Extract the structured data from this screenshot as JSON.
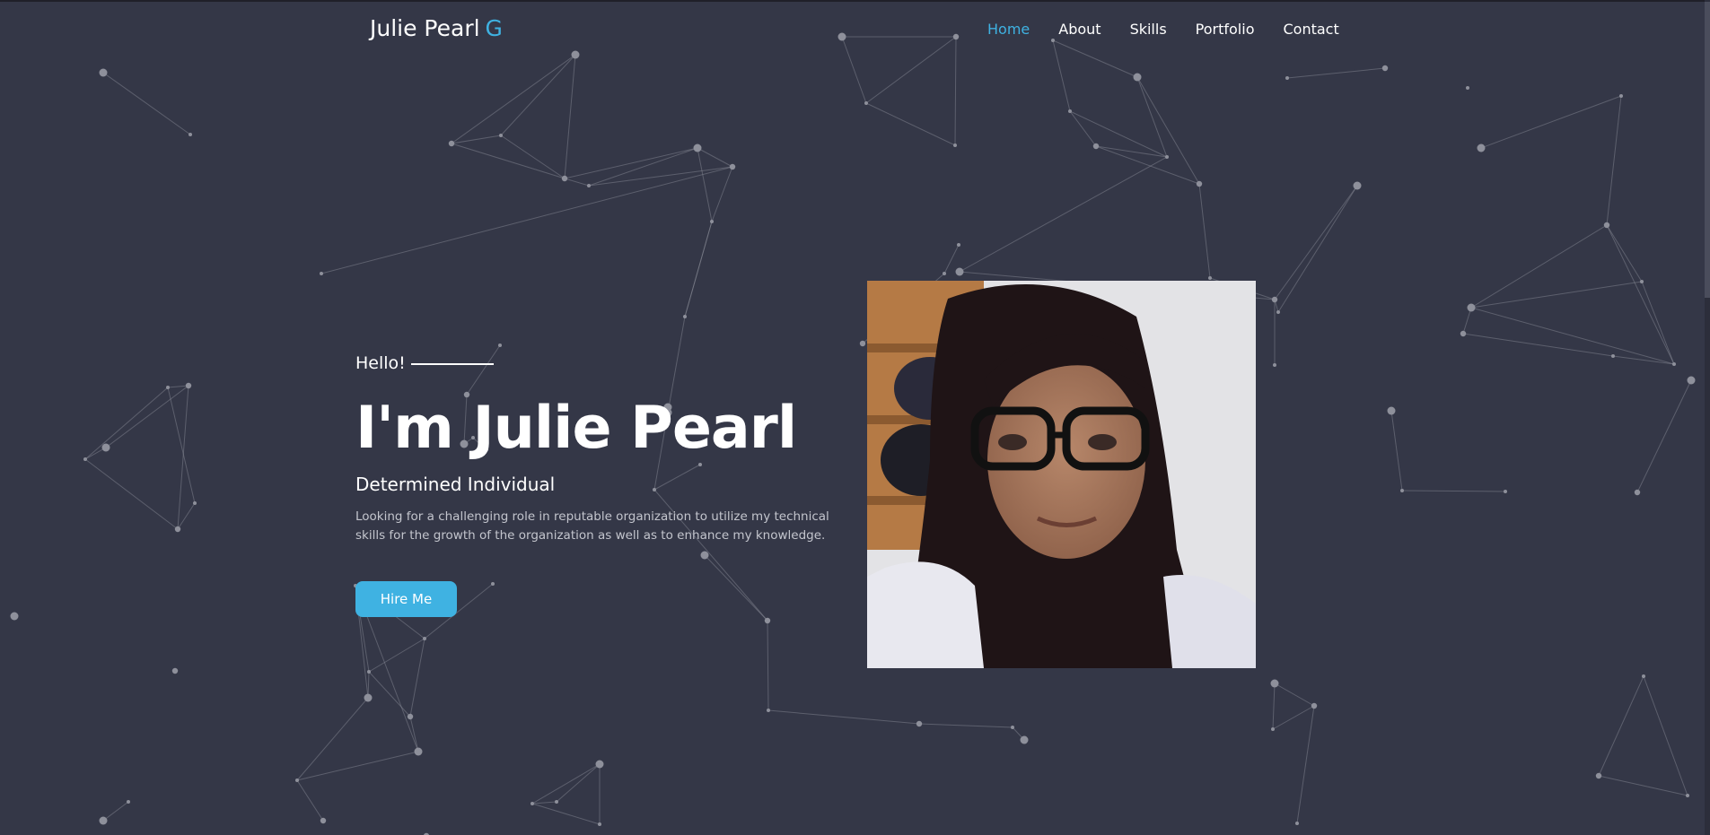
{
  "brand": {
    "name": "Julie Pearl",
    "mark": "G"
  },
  "nav": {
    "items": [
      {
        "label": "Home",
        "active": true
      },
      {
        "label": "About",
        "active": false
      },
      {
        "label": "Skills",
        "active": false
      },
      {
        "label": "Portfolio",
        "active": false
      },
      {
        "label": "Contact",
        "active": false
      }
    ]
  },
  "hero": {
    "greeting": "Hello!",
    "headline": "I'm Julie Pearl",
    "subtitle": "Determined Individual",
    "description": "Looking for a challenging role in reputable organization to utilize my technical skills for the growth of the organization as well as to enhance my knowledge.",
    "cta_label": "Hire Me"
  },
  "colors": {
    "background": "#343747",
    "accent": "#3fb2e2",
    "particles": "#8e909b"
  }
}
